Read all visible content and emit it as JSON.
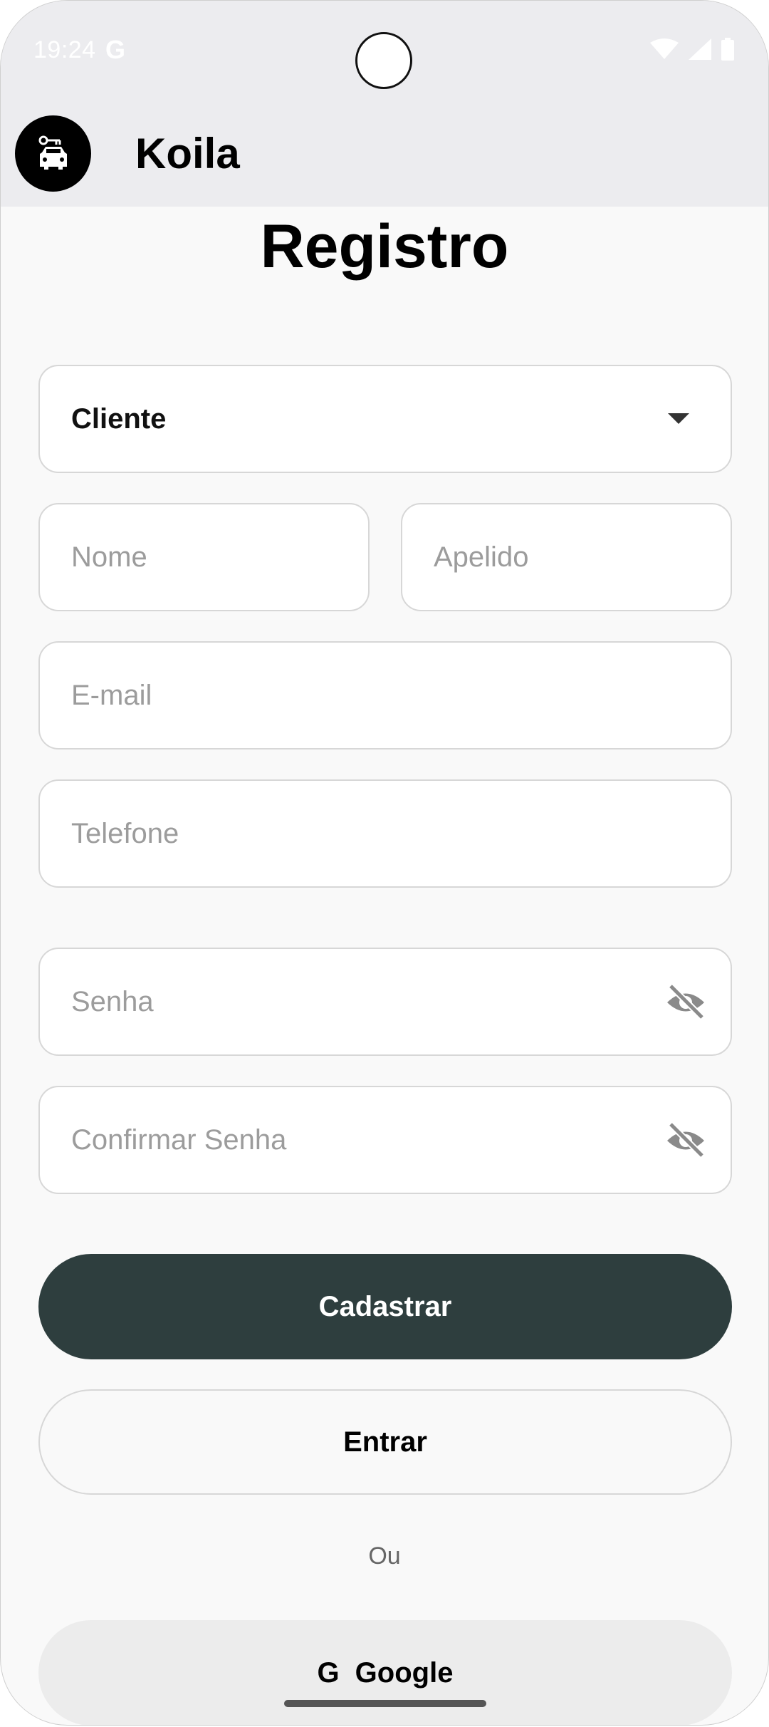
{
  "status_bar": {
    "time": "19:24",
    "g_badge": "G"
  },
  "app_bar": {
    "title": "Koila"
  },
  "page": {
    "title": "Registro"
  },
  "form": {
    "role_select_value": "Cliente",
    "first_name_placeholder": "Nome",
    "last_name_placeholder": "Apelido",
    "email_placeholder": "E-mail",
    "phone_placeholder": "Telefone",
    "password_placeholder": "Senha",
    "confirm_password_placeholder": "Confirmar Senha"
  },
  "buttons": {
    "register": "Cadastrar",
    "login": "Entrar",
    "or": "Ou",
    "google_icon": "G",
    "google": "Google"
  },
  "colors": {
    "primary": "#2e3e3e",
    "surface": "#f9f9f9",
    "app_bar": "#ececef"
  },
  "icons": [
    "car-logo-icon",
    "wifi-icon",
    "signal-icon",
    "battery-icon",
    "dropdown-caret-icon",
    "visibility-off-icon"
  ]
}
